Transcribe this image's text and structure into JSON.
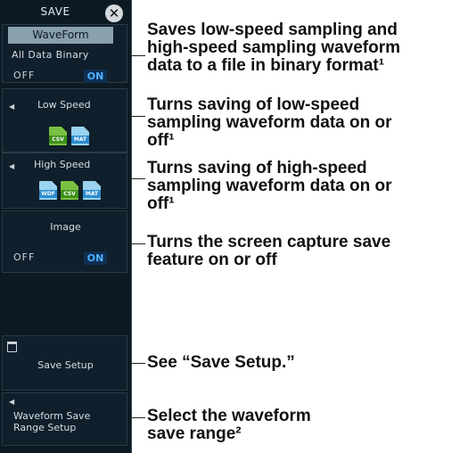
{
  "menu": {
    "title": "SAVE",
    "close_icon": "close-icon",
    "waveform_tab": "WaveForm",
    "all_data_binary": {
      "label": "All Data Binary",
      "off": "OFF",
      "on": "ON",
      "state": "ON"
    },
    "low_speed": {
      "label": "Low Speed",
      "formats": [
        "CSV",
        "MAT"
      ]
    },
    "high_speed": {
      "label": "High Speed",
      "formats": [
        "WDF",
        "CSV",
        "MAT"
      ]
    },
    "image": {
      "label": "Image",
      "off": "OFF",
      "on": "ON",
      "state": "ON"
    },
    "save_setup": "Save Setup",
    "waveform_save_range": {
      "line1": "Waveform Save",
      "line2": "Range Setup"
    },
    "accent_on_color": "#4fb2ff"
  },
  "annotations": {
    "a1": [
      "Saves low-speed sampling and",
      "high-speed sampling waveform",
      "data to a file in binary format¹"
    ],
    "a2": [
      "Turns saving of low-speed",
      "sampling waveform data on or",
      "off¹"
    ],
    "a3": [
      "Turns saving of high-speed",
      "sampling waveform data on or",
      "off¹"
    ],
    "a4": [
      "Turns the screen capture save",
      "feature on or off"
    ],
    "a5": [
      "See “Save Setup.”"
    ],
    "a6": [
      "Select the waveform",
      "save range²"
    ]
  }
}
